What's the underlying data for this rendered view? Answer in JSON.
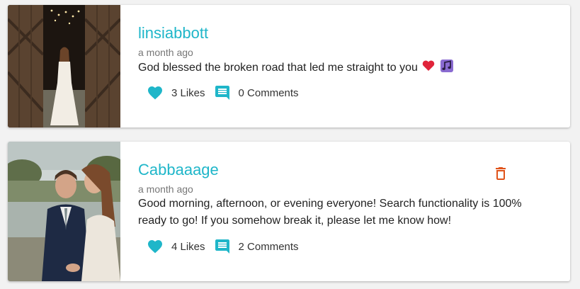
{
  "colors": {
    "accent": "#1fb6c9",
    "delete": "#e0531a",
    "heart_emoji": "#e0243a",
    "music_emoji": "#8a6bd1"
  },
  "posts": [
    {
      "username": "linsiabbott",
      "timestamp": "a month ago",
      "message": "God blessed the broken road that led me straight to you",
      "emojis": [
        "red-heart-emoji",
        "musical-notes-emoji"
      ],
      "likes_label": "3 Likes",
      "comments_label": "0 Comments",
      "can_delete": false,
      "image": "bride-in-barn-doorway-photo"
    },
    {
      "username": "Cabbaaage",
      "timestamp": "a month ago",
      "message": "Good morning, afternoon, or evening everyone! Search functionality is 100% ready to go! If you somehow break it, please let me know how!",
      "emojis": [],
      "likes_label": "4 Likes",
      "comments_label": "2 Comments",
      "can_delete": true,
      "image": "wedding-couple-kiss-photo"
    }
  ]
}
